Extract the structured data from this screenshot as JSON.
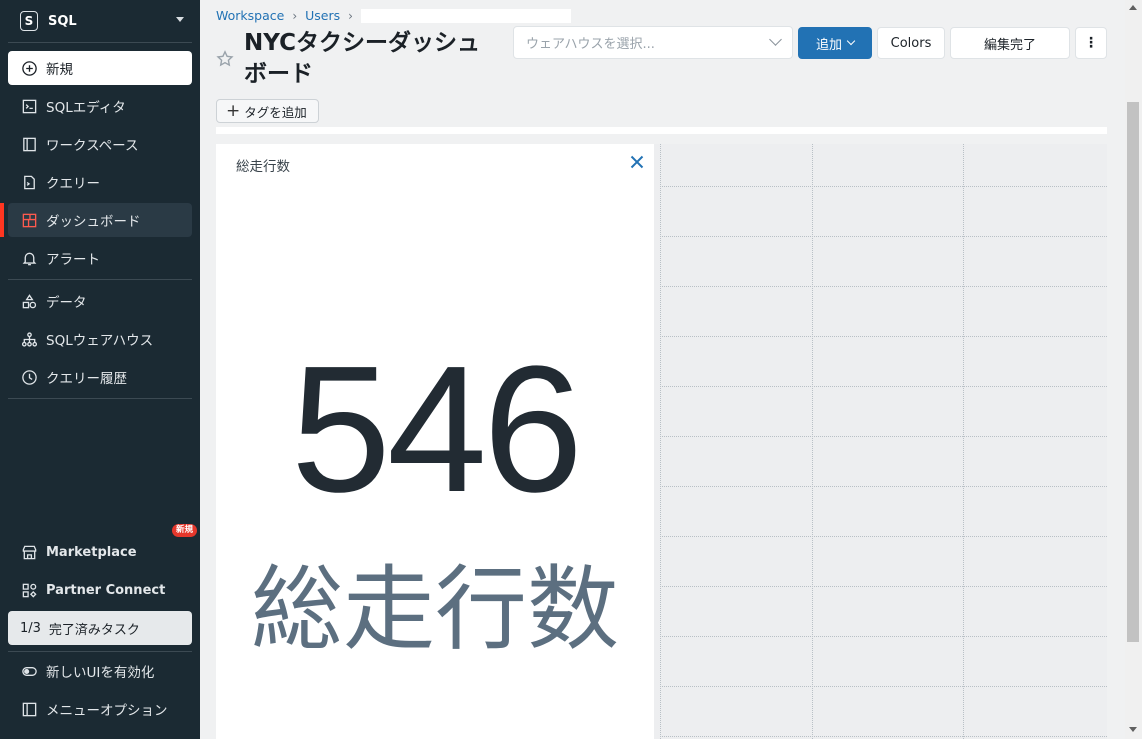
{
  "sidebar": {
    "persona": {
      "badge": "S",
      "label": "SQL",
      "icon": "chevron-down-icon"
    },
    "new_item": {
      "label": "新規",
      "icon": "plus-circle-icon"
    },
    "nav": [
      {
        "label": "SQLエディタ",
        "icon": "sql-editor-icon"
      },
      {
        "label": "ワークスペース",
        "icon": "workspace-icon"
      },
      {
        "label": "クエリー",
        "icon": "query-file-icon"
      },
      {
        "label": "ダッシュボード",
        "icon": "dashboard-icon",
        "active": true
      },
      {
        "label": "アラート",
        "icon": "bell-icon"
      }
    ],
    "data_nav": [
      {
        "label": "データ",
        "icon": "data-shapes-icon"
      },
      {
        "label": "SQLウェアハウス",
        "icon": "warehouse-icon"
      },
      {
        "label": "クエリー履歴",
        "icon": "clock-icon"
      }
    ],
    "bottom": {
      "marketplace": {
        "label": "Marketplace",
        "badge": "新規",
        "icon": "store-icon"
      },
      "partner_connect": {
        "label": "Partner Connect",
        "icon": "partner-icon"
      },
      "tasks": {
        "count": "1/3",
        "label": "完了済みタスク"
      },
      "new_ui": {
        "label": "新しいUIを有効化",
        "icon": "toggle-icon"
      },
      "menu_options": {
        "label": "メニューオプション",
        "icon": "sidebar-panel-icon"
      }
    },
    "active_color": "#ff3621"
  },
  "header": {
    "breadcrumb": [
      "Workspace",
      "Users"
    ],
    "title": "NYCタクシーダッシュボード",
    "title_line1": "NYCタクシーダッシュ",
    "title_line2": "ボード",
    "warehouse_placeholder": "ウェアハウスを選択...",
    "add_label": "追加",
    "colors_label": "Colors",
    "done_label": "編集完了",
    "kebab_label": "⋮",
    "add_tag_label": "タグを追加",
    "accent_color": "#2272b4"
  },
  "widget": {
    "title": "総走行数",
    "counter_value": "546",
    "counter_label": "総走行数"
  }
}
